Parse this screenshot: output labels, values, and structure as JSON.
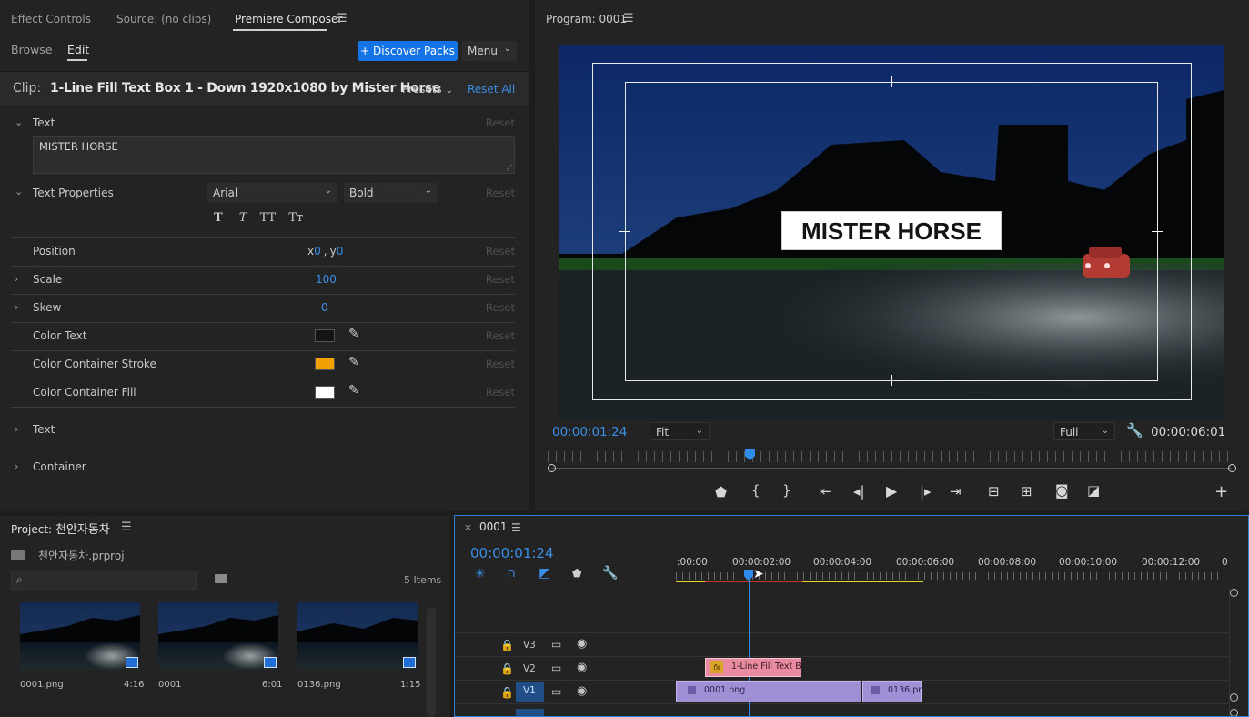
{
  "effect_panel": {
    "tabs": [
      "Effect Controls",
      "Source: (no clips)",
      "Premiere Composer"
    ],
    "subtabs": [
      "Browse",
      "Edit"
    ],
    "discover_label": "+ Discover Packs",
    "menu_label": "Menu",
    "clip_prefix": "Clip:",
    "clip_name": "1-Line Fill Text Box 1 - Down 1920x1080 by Mister Horse",
    "presets_label": "Presets",
    "reset_all_label": "Reset All",
    "reset_label": "Reset",
    "text_section": "Text",
    "text_value": "MISTER HORSE",
    "text_props_section": "Text Properties",
    "font_family": "Arial",
    "font_style": "Bold",
    "style_buttons": [
      "T",
      "T",
      "TT",
      "Tт"
    ],
    "position_label": "Position",
    "position_x_prefix": "x",
    "position_x": "0",
    "position_sep": ",",
    "position_y_prefix": "y",
    "position_y": "0",
    "scale_label": "Scale",
    "scale_value": "100",
    "skew_label": "Skew",
    "skew_value": "0",
    "color_text_label": "Color Text",
    "color_text": "#141414",
    "stroke_label": "Color Container Stroke",
    "stroke_color": "#f0a000",
    "fill_label": "Color Container Fill",
    "fill_color": "#ffffff",
    "text_group": "Text",
    "container_group": "Container"
  },
  "program": {
    "title": "Program: 0001",
    "overlay_text": "MISTER HORSE",
    "timecode_current": "00:00:01:24",
    "fit_label": "Fit",
    "quality_label": "Full",
    "timecode_duration": "00:00:06:01"
  },
  "project": {
    "title_prefix": "Project:",
    "title_name": "천안자동차",
    "file_name": "천안자동차.prproj",
    "items_count": "5 Items",
    "search_placeholder": "",
    "thumbs": [
      {
        "name": "0001.png",
        "duration": "4:16"
      },
      {
        "name": "0001",
        "duration": "6:01"
      },
      {
        "name": "0136.png",
        "duration": "1:15"
      }
    ]
  },
  "timeline": {
    "tab_name": "0001",
    "timecode": "00:00:01:24",
    "ruler": [
      ":00:00",
      "00:00:02:00",
      "00:00:04:00",
      "00:00:06:00",
      "00:00:08:00",
      "00:00:10:00",
      "00:00:12:00",
      "0"
    ],
    "tracks": [
      "V3",
      "V2",
      "V1"
    ],
    "clip_v2": "1-Line Fill Text B",
    "clip_v1_a": "0001.png",
    "clip_v1_b": "0136.pn",
    "fx_badge": "fx"
  },
  "colors": {
    "accent_blue": "#2d8ceb",
    "discover_bg": "#1473e6",
    "clip_pink": "#e88aa0",
    "clip_purple": "#a18fd6",
    "work_yellow": "#e5d22a",
    "render_red": "#c0392b"
  }
}
